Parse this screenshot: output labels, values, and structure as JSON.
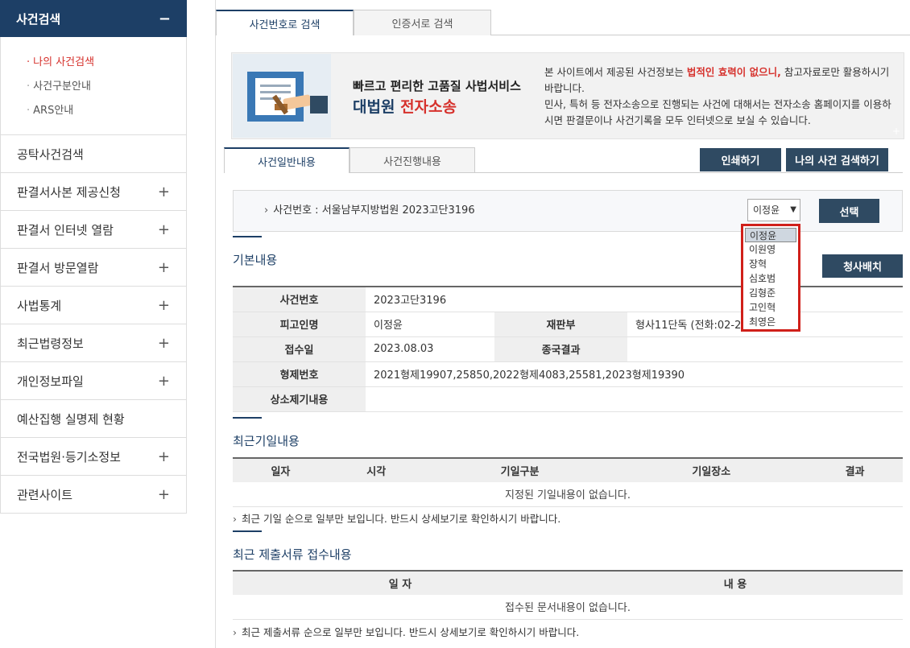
{
  "sidebar": {
    "header": "사건검색",
    "submenu": [
      "나의 사건검색",
      "사건구분안내",
      "ARS안내"
    ],
    "items": [
      {
        "label": "공탁사건검색",
        "expand": ""
      },
      {
        "label": "판결서사본 제공신청",
        "expand": "+"
      },
      {
        "label": "판결서 인터넷 열람",
        "expand": "+"
      },
      {
        "label": "판결서 방문열람",
        "expand": "+"
      },
      {
        "label": "사법통계",
        "expand": "+"
      },
      {
        "label": "최근법령정보",
        "expand": "+"
      },
      {
        "label": "개인정보파일",
        "expand": "+"
      },
      {
        "label": "예산집행 실명제 현황",
        "expand": ""
      },
      {
        "label": "전국법원·등기소정보",
        "expand": "+"
      },
      {
        "label": "관련사이트",
        "expand": "+"
      }
    ]
  },
  "top_tabs": [
    "사건번호로 검색",
    "인증서로 검색"
  ],
  "banner": {
    "line1": "빠르고 편리한 고품질 사법서비스",
    "line2a": "대법원",
    "line2b": "전자소송",
    "text_1": "본 사이트에서 제공된 사건정보는 ",
    "text_red": "법적인 효력이 없으니,",
    "text_2": " 참고자료로만 활용하시기 바랍니다.",
    "text_3": "민사, 특허 등 전자소송으로 진행되는 사건에 대해서는 전자소송 홈페이지를 이용하시면 판결문이나 사건기록을 모두 인터넷으로 보실 수 있습니다."
  },
  "sub_tabs": [
    "사건일반내용",
    "사건진행내용"
  ],
  "buttons": {
    "print": "인쇄하기",
    "my_search": "나의 사건 검색하기",
    "select": "선택",
    "staff": "청사배치"
  },
  "case": {
    "label": "사건번호 : 서울남부지방법원 2023고단3196",
    "selected": "이정윤"
  },
  "dropdown_options": [
    "이정윤",
    "이원영",
    "장혁",
    "심호범",
    "김형준",
    "고인혁",
    "최영은"
  ],
  "basic": {
    "title": "기본내용",
    "rows": [
      {
        "h1": "사건번호",
        "v1": "2023고단3196",
        "h2": "",
        "v2": ""
      },
      {
        "h1": "피고인명",
        "v1": "이정윤",
        "h2": "재판부",
        "v2": "형사11단독 (전화:02-2"
      },
      {
        "h1": "접수일",
        "v1": "2023.08.03",
        "h2": "종국결과",
        "v2": ""
      },
      {
        "h1": "형제번호",
        "v1": "2021형제19907,25850,2022형제4083,25581,2023형제19390"
      },
      {
        "h1": "상소제기내용",
        "v1": ""
      }
    ]
  },
  "hearing": {
    "title": "최근기일내용",
    "cols": [
      "일자",
      "시각",
      "기일구분",
      "기일장소",
      "결과"
    ],
    "empty": "지정된 기일내용이 없습니다.",
    "note": "최근 기일 순으로 일부만 보입니다. 반드시 상세보기로 확인하시기 바랍니다."
  },
  "submissions": {
    "title": "최근 제출서류 접수내용",
    "cols": [
      "일 자",
      "내 용"
    ],
    "empty": "접수된 문서내용이 없습니다.",
    "note": "최근 제출서류 순으로 일부만 보입니다. 반드시 상세보기로 확인하시기 바랍니다."
  }
}
